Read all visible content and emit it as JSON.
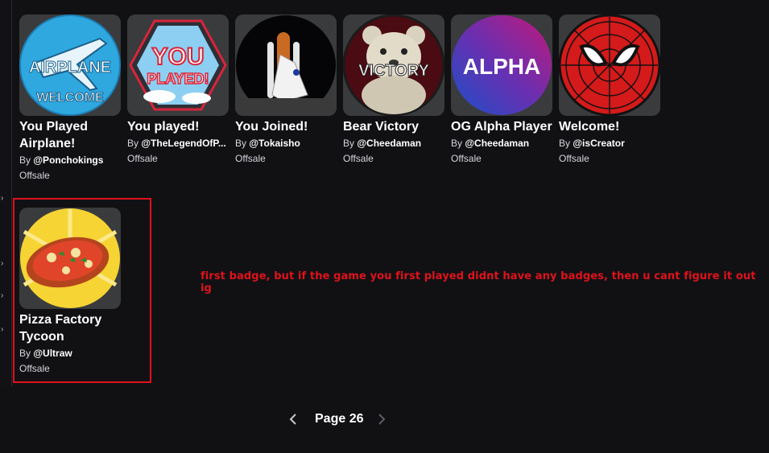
{
  "badges": [
    {
      "title": "You Played Airplane!",
      "by": "By",
      "creator": "@Ponchokings",
      "price": "Offsale",
      "icon": "airplane-welcome-badge-icon",
      "text": "AIRPLANE",
      "text2": "WELCOME"
    },
    {
      "title": "You played!",
      "by": "By",
      "creator": "@TheLegendOfP...",
      "price": "Offsale",
      "icon": "you-played-badge-icon",
      "text": "YOU",
      "text2": "PLAYED!"
    },
    {
      "title": "You Joined!",
      "by": "By",
      "creator": "@Tokaisho",
      "price": "Offsale",
      "icon": "space-shuttle-badge-icon"
    },
    {
      "title": "Bear Victory",
      "by": "By",
      "creator": "@Cheedaman",
      "price": "Offsale",
      "icon": "bear-victory-badge-icon",
      "text": "VICTORY"
    },
    {
      "title": "OG Alpha Player",
      "by": "By",
      "creator": "@Cheedaman",
      "price": "Offsale",
      "icon": "alpha-badge-icon",
      "text": "ALPHA"
    },
    {
      "title": "Welcome!",
      "by": "By",
      "creator": "@isCreator",
      "price": "Offsale",
      "icon": "spiderman-mask-badge-icon"
    },
    {
      "title": "Pizza Factory Tycoon",
      "by": "By",
      "creator": "@Ultraw",
      "price": "Offsale",
      "icon": "pizza-badge-icon"
    }
  ],
  "annotation": "first badge, but if the game you first played didnt have any badges, then u cant figure it out ig",
  "pagination": {
    "label": "Page 26"
  },
  "colors": {
    "background": "#111114",
    "annotation": "#e0121b",
    "card": "#393b3d"
  }
}
